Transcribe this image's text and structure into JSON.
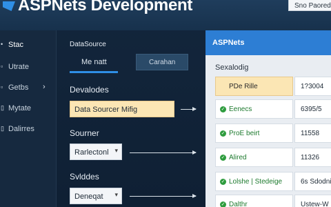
{
  "app": {
    "title": "ASPNets Development",
    "header_button": "Sno Paored"
  },
  "sidebar": {
    "items": [
      {
        "label": "Stac",
        "icon": "dot-icon",
        "glyph": "•",
        "active": true
      },
      {
        "label": "Utrate",
        "icon": "document-icon",
        "glyph": "▫"
      },
      {
        "label": "Getbs",
        "icon": "tag-icon",
        "glyph": "▫",
        "chevron": "›"
      },
      {
        "label": "Mytate",
        "icon": "doc-icon",
        "glyph": "▯"
      },
      {
        "label": "Dalirres",
        "icon": "folder-icon",
        "glyph": "▯"
      }
    ]
  },
  "middle": {
    "datasource_label": "DataSource",
    "tab_active": "Me natt",
    "tab_button": "Carahan",
    "sections": [
      {
        "label": "Devalodes",
        "field_value": "Data Sourcer Mifig",
        "field_style": "yellow"
      },
      {
        "label": "Sourner",
        "field_value": "Rarlectonl",
        "field_style": "white"
      },
      {
        "label": "Svlddes",
        "field_value": "Deneqat",
        "field_style": "white"
      }
    ],
    "caret": "▾"
  },
  "right": {
    "header": "ASPNets",
    "subheading": "Sexalodig",
    "check_glyph": "✓",
    "rows": [
      {
        "name": "PDe Rille",
        "value": "1?3004",
        "head": true
      },
      {
        "name": "Eenecs",
        "value": "6395/5"
      },
      {
        "name": "ProE beirt",
        "value": "11558"
      },
      {
        "name": "Alired",
        "value": "11326"
      },
      {
        "name": "Lolshe | Stedeige",
        "value": "6s Sdodni"
      },
      {
        "name": "Dalthr",
        "value": "Ustew-W"
      }
    ]
  },
  "colors": {
    "accent": "#2f8fe6",
    "highlight": "#fbe6b4",
    "status_ok": "#2e9c3e"
  }
}
